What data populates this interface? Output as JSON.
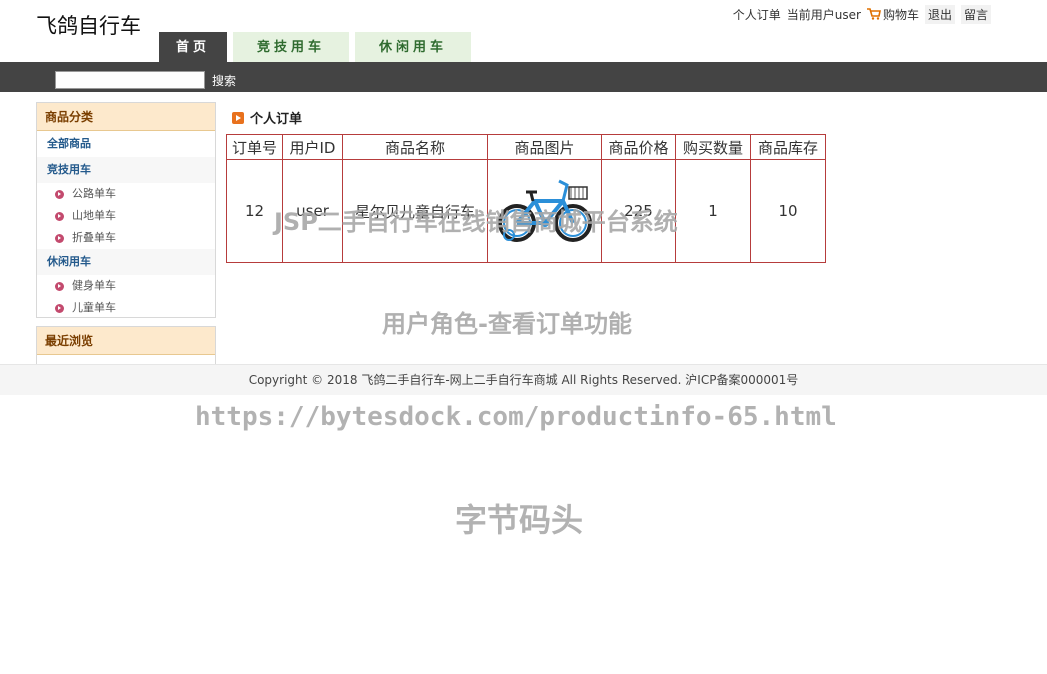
{
  "site": {
    "logo": "飞鸽自行车"
  },
  "top_links": {
    "orders": "个人订单",
    "current_user": "当前用户user",
    "cart": "购物车",
    "logout": "退出",
    "message": "留言"
  },
  "nav_tabs": [
    {
      "label": "首页"
    },
    {
      "label": "竞技用车"
    },
    {
      "label": "休闲用车"
    }
  ],
  "search": {
    "placeholder": "",
    "button": "搜索"
  },
  "sidebar": {
    "title": "商品分类",
    "all": "全部商品",
    "categories": [
      {
        "name": "竞技用车",
        "items": [
          "公路单车",
          "山地单车",
          "折叠单车"
        ]
      },
      {
        "name": "休闲用车",
        "items": [
          "健身单车",
          "儿童单车"
        ]
      }
    ],
    "recent_title": "最近浏览"
  },
  "main": {
    "title": "个人订单",
    "columns": [
      "订单号",
      "用户ID",
      "商品名称",
      "商品图片",
      "商品价格",
      "购买数量",
      "商品库存"
    ],
    "rows": [
      {
        "order_no": "12",
        "user_id": "user",
        "product_name": "星尔贝儿童自行车",
        "price": "225",
        "quantity": "1",
        "stock": "10"
      }
    ]
  },
  "footer": {
    "text": "Copyright © 2018 飞鸽二手自行车-网上二手自行车商城 All Rights Reserved. 沪ICP备案000001号"
  },
  "watermarks": {
    "line1": "JSP二手自行车在线销售商城平台系统",
    "line2": "用户角色-查看订单功能",
    "line3": "https://bytesdock.com/productinfo-65.html",
    "line4": "字节码头"
  },
  "colors": {
    "header_bar": "#444444",
    "tab_inactive": "#e6f2e0",
    "table_border": "#b63c3c",
    "sidebar_head": "#fde9cc"
  }
}
